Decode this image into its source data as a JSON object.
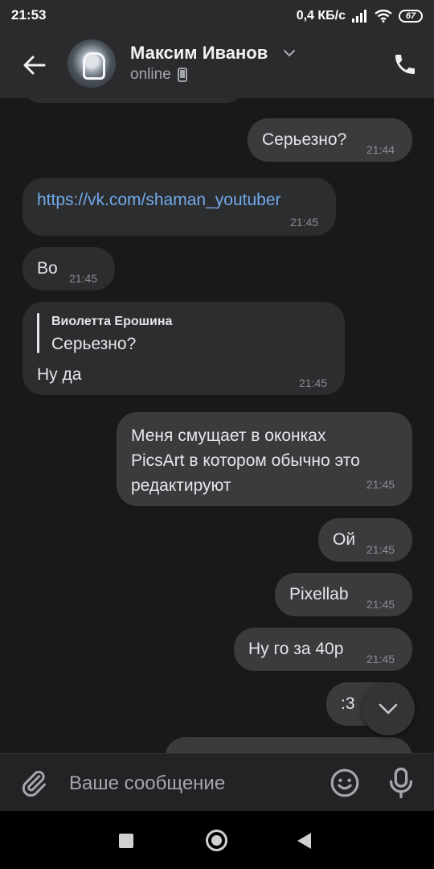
{
  "status_bar": {
    "time": "21:53",
    "speed": "0,4 КБ/с",
    "battery": "67"
  },
  "header": {
    "contact_name": "Максим Иванов",
    "status": "online"
  },
  "messages": [
    {
      "direction": "out",
      "text": "Серьезно?",
      "time": "21:44"
    },
    {
      "direction": "in",
      "text": "https://vk.com/shaman_youtuber",
      "time": "21:45"
    },
    {
      "direction": "in",
      "text": "Во",
      "time": "21:45"
    },
    {
      "direction": "in",
      "reply_author": "Виолетта Ерошина",
      "reply_text": "Серьезно?",
      "text": "Ну да",
      "time": "21:45"
    },
    {
      "direction": "out",
      "lines": [
        "Меня смущает в оконках",
        "PicsArt в котором обычно это",
        "редактируют"
      ],
      "time": "21:45"
    },
    {
      "direction": "out",
      "text": "Ой",
      "time": "21:45"
    },
    {
      "direction": "out",
      "text": "Pixellab",
      "time": "21:45"
    },
    {
      "direction": "out",
      "text": "Ну го за 40р",
      "time": "21:45"
    },
    {
      "direction": "out",
      "text": ":3",
      "time": ""
    }
  ],
  "composer": {
    "placeholder": "Ваше сообщение"
  },
  "icons": {
    "back": "arrow-left-icon",
    "chevron": "chevron-down-icon",
    "phone": "phone-icon",
    "mobile": "mobile-device-icon",
    "attach": "paperclip-icon",
    "emoji": "smile-icon",
    "mic": "microphone-icon",
    "scroll_down": "chevron-down-icon"
  },
  "colors": {
    "background": "#19191a",
    "header": "#2b2b2d",
    "bubble_in": "#2c2d2f",
    "bubble_out": "#3a3b3d",
    "link": "#71aaeb"
  }
}
